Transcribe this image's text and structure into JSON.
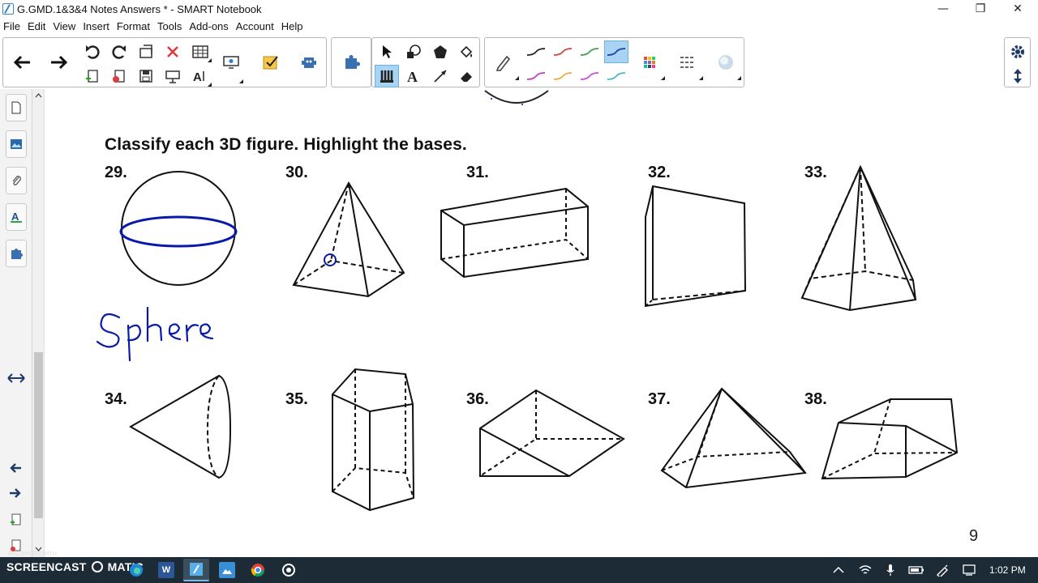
{
  "window": {
    "title": "G.GMD.1&3&4 Notes Answers * - SMART Notebook",
    "minimize": "—",
    "restore": "❐",
    "close": "✕"
  },
  "menu": [
    "File",
    "Edit",
    "View",
    "Insert",
    "Format",
    "Tools",
    "Add-ons",
    "Account",
    "Help"
  ],
  "page": {
    "heading": "Classify each 3D figure. Highlight the bases.",
    "handwriting": "Sphere",
    "page_number": "9",
    "questions": [
      "29.",
      "30.",
      "31.",
      "32.",
      "33.",
      "34.",
      "35.",
      "36.",
      "37.",
      "38."
    ]
  },
  "taskbar": {
    "recorded_label": "RECORDED WITH",
    "screencast_label": "SCREENCAST",
    "matic_label": "MATIC",
    "clock": "1:02 PM"
  },
  "colors": {
    "ink_blue": "#0a1aa8",
    "selected_tool": "#a9d3f3",
    "taskbar": "#1c2b36"
  }
}
